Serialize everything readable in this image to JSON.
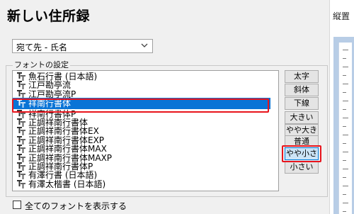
{
  "dialog": {
    "title": "新しい住所録",
    "preview_label": "縦置"
  },
  "recipient_select": {
    "value": "宛て先 - 氏名"
  },
  "font_group": {
    "label": "フォントの設定"
  },
  "font_list": {
    "items": [
      "魚石行書 (日本語)",
      "江戸勘亭流",
      "江戸勘亭流P",
      "祥南行書体",
      "祥南行書体P",
      "正調祥南行書体",
      "正調祥南行書体EX",
      "正調祥南行書体EXP",
      "正調祥南行書体MAX",
      "正調祥南行書体MAXP",
      "正調祥南行書体P",
      "有澤行書 (日本語)",
      "有澤太楷書 (日本語)"
    ],
    "selected_index": 3
  },
  "style_buttons": {
    "bold": "太字",
    "italic": "斜体",
    "underline": "下線"
  },
  "size_buttons": {
    "large": "大きい",
    "somewhat_large": "やや大きい",
    "normal": "普通",
    "somewhat_small": "やや小さい",
    "small": "小さい",
    "selected": "somewhat_small"
  },
  "show_all_fonts": {
    "label": "全てのフォントを表示する",
    "checked": false
  },
  "colors": {
    "selection": "#0a74d6",
    "highlight_box": "#e8141c",
    "preview_background": "#b8cde6"
  }
}
